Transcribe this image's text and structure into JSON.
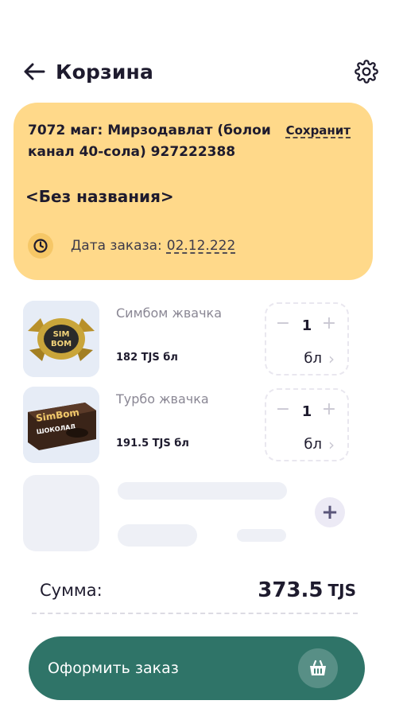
{
  "header": {
    "title": "Корзина",
    "back_icon": "arrow-left-icon",
    "settings_icon": "gear-icon"
  },
  "order": {
    "store": "7072 маг: Мирзодавлат (болои канал 40-сола) 927222388",
    "save_label": "Сохранит",
    "name": "<Без названия>",
    "date_label": "Дата заказа:",
    "date_value": "02.12.222",
    "clock_icon": "clock-icon"
  },
  "products": [
    {
      "name": "Симбом жвачка",
      "price": "182 TJS бл",
      "quantity": "1",
      "unit": "бл",
      "image_text_top": "SIM",
      "image_text_bottom": "BOM"
    },
    {
      "name": "Турбо жвачка",
      "price": "191.5 TJS бл",
      "quantity": "1",
      "unit": "бл",
      "image_text_top": "SimBom",
      "image_text_bottom": "ШОКОЛАД"
    }
  ],
  "summary": {
    "label": "Сумма:",
    "value": "373.5",
    "currency": "TJS"
  },
  "checkout": {
    "label": "Оформить заказ",
    "icon": "basket-icon"
  },
  "colors": {
    "card_bg": "#ffd98a",
    "accent": "#2f7468",
    "muted": "#8a8794"
  }
}
